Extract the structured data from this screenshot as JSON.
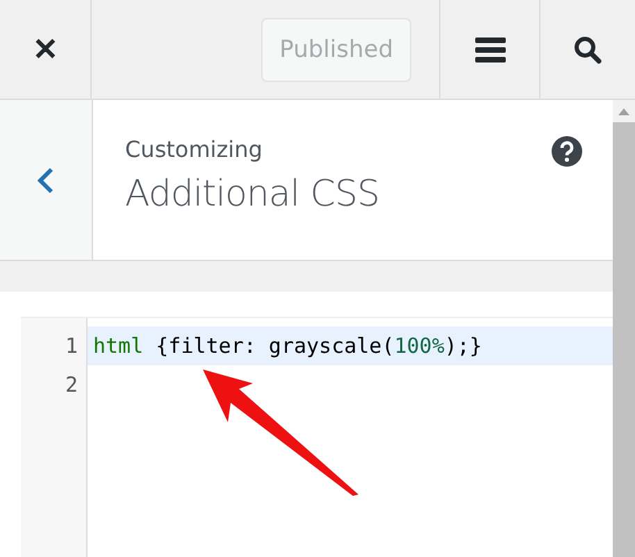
{
  "toolbar": {
    "close": "✕",
    "publish_button": {
      "label": "Published",
      "disabled": true
    }
  },
  "section": {
    "subtitle": "Customizing",
    "title": "Additional CSS"
  },
  "editor": {
    "lines": [
      {
        "number": "1",
        "active": true,
        "tokens": [
          {
            "kind": "tag",
            "text": "html"
          },
          {
            "kind": "plain",
            "text": " {filter: grayscale("
          },
          {
            "kind": "number",
            "text": "100%"
          },
          {
            "kind": "plain",
            "text": ");}"
          }
        ]
      },
      {
        "number": "2",
        "active": false
      }
    ]
  }
}
